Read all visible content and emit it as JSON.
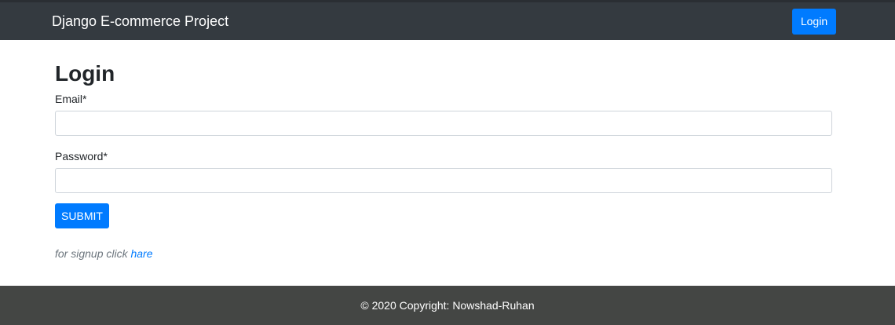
{
  "navbar": {
    "brand": "Django E-commerce Project",
    "login_label": "Login",
    "background_color": "#343a40",
    "button_color": "#007bff"
  },
  "main": {
    "title": "Login",
    "email_label": "Email*",
    "email_value": "",
    "password_label": "Password*",
    "password_value": "",
    "submit_label": "SUBMIT",
    "signup_prefix": "for signup click",
    "signup_link": "hare"
  },
  "footer": {
    "copyright": "© 2020 Copyright: Nowshad-Ruhan",
    "background_color": "#444644"
  }
}
